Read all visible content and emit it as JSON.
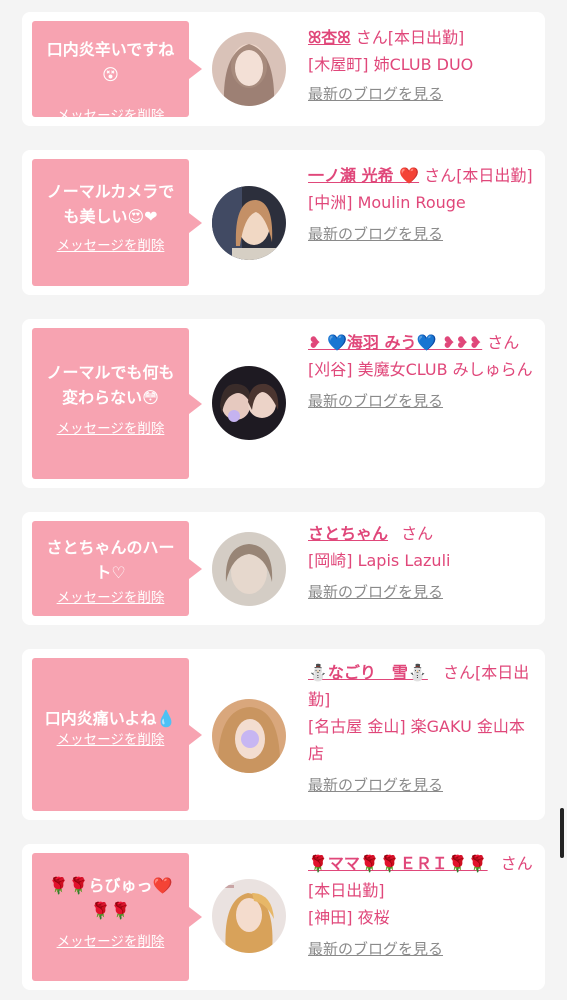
{
  "delete_label": "メッセージを削除",
  "blog_label": "最新のブログを見る",
  "cards": [
    {
      "message": "口内炎辛いですね😵",
      "name": "ꕤ杏ꕤ",
      "san": "さん",
      "status": "[本日出勤]",
      "shop": "[木屋町] 姉CLUB DUO"
    },
    {
      "message": "ノーマルカメラでも美しい😍❤",
      "name": "一ノ瀬 光希 ❤️",
      "san": "さん",
      "status": "[本日出勤]",
      "shop": "[中洲] Moulin Rouge"
    },
    {
      "message": "ノーマルでも何も変わらない😳",
      "name": "❥ 💙海羽 みう💙 ❥❥❥",
      "san": "さん",
      "status": "",
      "shop": "[刈谷] 美魔女CLUB みしゅらん"
    },
    {
      "message": "さとちゃんのハート♡",
      "name": "さとちゃん",
      "san": "さん",
      "status": "",
      "shop": "[岡崎] Lapis Lazuli"
    },
    {
      "message": "口内炎痛いよね💧",
      "name": "⛄なごり　雪⛄",
      "san": "さん",
      "status": "[本日出勤]",
      "shop": "[名古屋 金山] 楽GAKU 金山本店"
    },
    {
      "message": "🌹🌹らびゅっ❤️🌹🌹",
      "name": "🌹ママ🌹🌹ＥＲＩ🌹🌹",
      "san": "さん",
      "status": "[本日出勤]",
      "shop": "[神田] 夜桜"
    }
  ],
  "colors": {
    "bubble": "#f7a3b1",
    "accent": "#e0477a",
    "link_gray": "#8a8a8a",
    "background": "#f4f4f4"
  }
}
